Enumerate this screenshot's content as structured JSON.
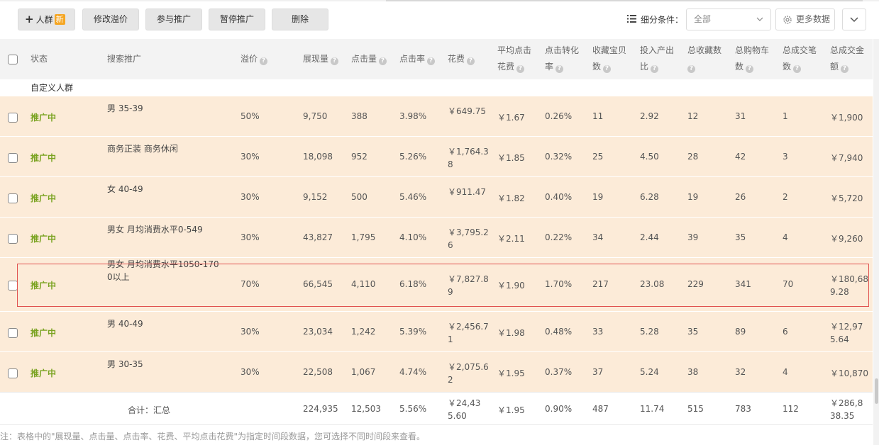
{
  "toolbar": {
    "add_label": "人群",
    "new_badge": "新",
    "modify_premium": "修改溢价",
    "join_promotion": "参与推广",
    "pause_promotion": "暂停推广",
    "delete": "删除",
    "filter_label": "细分条件：",
    "filter_value": "全部",
    "more_data": "更多数据"
  },
  "headers": {
    "status": "状态",
    "search": "搜索推广",
    "premium": "溢价",
    "impressions": "展现量",
    "clicks": "点击量",
    "ctr": "点击率",
    "cost": "花费",
    "avg_cpc_1": "平均点击",
    "avg_cpc_2": "花费",
    "cvr_1": "点击转化",
    "cvr_2": "率",
    "fav_item_1": "收藏宝贝",
    "fav_item_2": "数",
    "roi_1": "投入产出",
    "roi_2": "比",
    "total_fav_1": "总收藏数",
    "cart_1": "总购物车",
    "cart_2": "数",
    "orders_1": "总成交笔",
    "orders_2": "数",
    "gmv_1": "总成交金",
    "gmv_2": "额"
  },
  "group_label": "自定义人群",
  "rows": [
    {
      "status": "推广中",
      "name": "男 35-39",
      "premium": "50%",
      "impressions": "9,750",
      "clicks": "388",
      "ctr": "3.98%",
      "cost": "￥649.75",
      "avg_cpc": "￥1.67",
      "cvr": "0.26%",
      "fav_item": "11",
      "roi": "2.92",
      "total_fav": "12",
      "cart": "31",
      "orders": "1",
      "gmv": "￥1,900"
    },
    {
      "status": "推广中",
      "name": "商务正装 商务休闲",
      "premium": "30%",
      "impressions": "18,098",
      "clicks": "952",
      "ctr": "5.26%",
      "cost": "￥1,764.38",
      "avg_cpc": "￥1.85",
      "cvr": "0.32%",
      "fav_item": "25",
      "roi": "4.50",
      "total_fav": "28",
      "cart": "42",
      "orders": "3",
      "gmv": "￥7,940"
    },
    {
      "status": "推广中",
      "name": "女 40-49",
      "premium": "30%",
      "impressions": "9,152",
      "clicks": "500",
      "ctr": "5.46%",
      "cost": "￥911.47",
      "avg_cpc": "￥1.82",
      "cvr": "0.40%",
      "fav_item": "19",
      "roi": "6.28",
      "total_fav": "19",
      "cart": "26",
      "orders": "2",
      "gmv": "￥5,720"
    },
    {
      "status": "推广中",
      "name": "男女 月均消费水平0-549",
      "premium": "30%",
      "impressions": "43,827",
      "clicks": "1,795",
      "ctr": "4.10%",
      "cost": "￥3,795.26",
      "avg_cpc": "￥2.11",
      "cvr": "0.22%",
      "fav_item": "34",
      "roi": "2.44",
      "total_fav": "39",
      "cart": "35",
      "orders": "4",
      "gmv": "￥9,260"
    },
    {
      "status": "推广中",
      "name": "男女 月均消费水平1050-1700以上",
      "premium": "70%",
      "impressions": "66,545",
      "clicks": "4,110",
      "ctr": "6.18%",
      "cost": "￥7,827.89",
      "avg_cpc": "￥1.90",
      "cvr": "1.70%",
      "fav_item": "217",
      "roi": "23.08",
      "total_fav": "229",
      "cart": "341",
      "orders": "70",
      "gmv": "￥180,689.28"
    },
    {
      "status": "推广中",
      "name": "男 40-49",
      "premium": "30%",
      "impressions": "23,034",
      "clicks": "1,242",
      "ctr": "5.39%",
      "cost": "￥2,456.71",
      "avg_cpc": "￥1.98",
      "cvr": "0.48%",
      "fav_item": "33",
      "roi": "5.28",
      "total_fav": "35",
      "cart": "89",
      "orders": "6",
      "gmv": "￥12,975.64"
    },
    {
      "status": "推广中",
      "name": "男 30-35",
      "premium": "30%",
      "impressions": "22,508",
      "clicks": "1,067",
      "ctr": "4.74%",
      "cost": "￥2,075.62",
      "avg_cpc": "￥1.95",
      "cvr": "0.37%",
      "fav_item": "37",
      "roi": "5.24",
      "total_fav": "38",
      "cart": "32",
      "orders": "4",
      "gmv": "￥10,870"
    }
  ],
  "total": {
    "label": "合计：汇总",
    "impressions": "224,935",
    "clicks": "12,503",
    "ctr": "5.56%",
    "cost": "￥24,435.60",
    "avg_cpc": "￥1.95",
    "cvr": "0.90%",
    "fav_item": "487",
    "roi": "11.74",
    "total_fav": "515",
    "cart": "783",
    "orders": "112",
    "gmv": "￥286,838.35"
  },
  "note": "注：表格中的\"展现量、点击量、点击率、花费、平均点击花费\"为指定时间段数据，您可选择不同时间段来查看。",
  "colors": {
    "status_active": "#7aa321",
    "row_bg": "#fcebd8",
    "highlight_border": "#e0514f",
    "new_badge": "#f5a623"
  }
}
